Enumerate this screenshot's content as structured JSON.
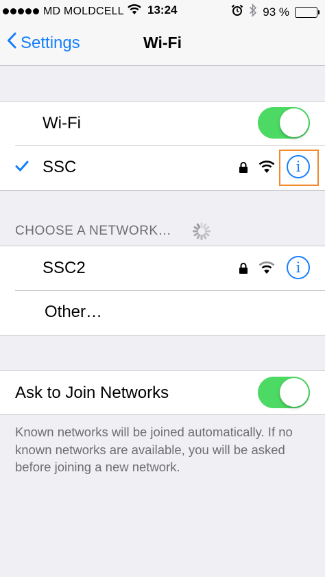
{
  "status_bar": {
    "carrier": "MD MOLDCELL",
    "time": "13:24",
    "battery_percent": "93 %",
    "battery_level": 0.93,
    "signal_icon": "signal-dots-icon",
    "wifi_icon": "wifi-icon",
    "alarm_icon": "alarm-icon",
    "bluetooth_icon": "bluetooth-icon",
    "battery_icon": "battery-icon"
  },
  "nav": {
    "back_label": "Settings",
    "title": "Wi-Fi"
  },
  "wifi_group": {
    "toggle_label": "Wi-Fi",
    "toggle_on": true,
    "connected_network": "SSC",
    "connected_secured": true
  },
  "choose_section": {
    "header": "CHOOSE A NETWORK…",
    "networks": [
      {
        "name": "SSC2",
        "secured": true
      }
    ],
    "other_label": "Other…"
  },
  "ask_group": {
    "label": "Ask to Join Networks",
    "toggle_on": true,
    "footer": "Known networks will be joined automatically. If no known networks are available, you will be asked before joining a new network."
  },
  "colors": {
    "accent": "#157efb",
    "toggle_on": "#4cd964",
    "highlight": "#f08a2c",
    "background": "#efeff4"
  }
}
